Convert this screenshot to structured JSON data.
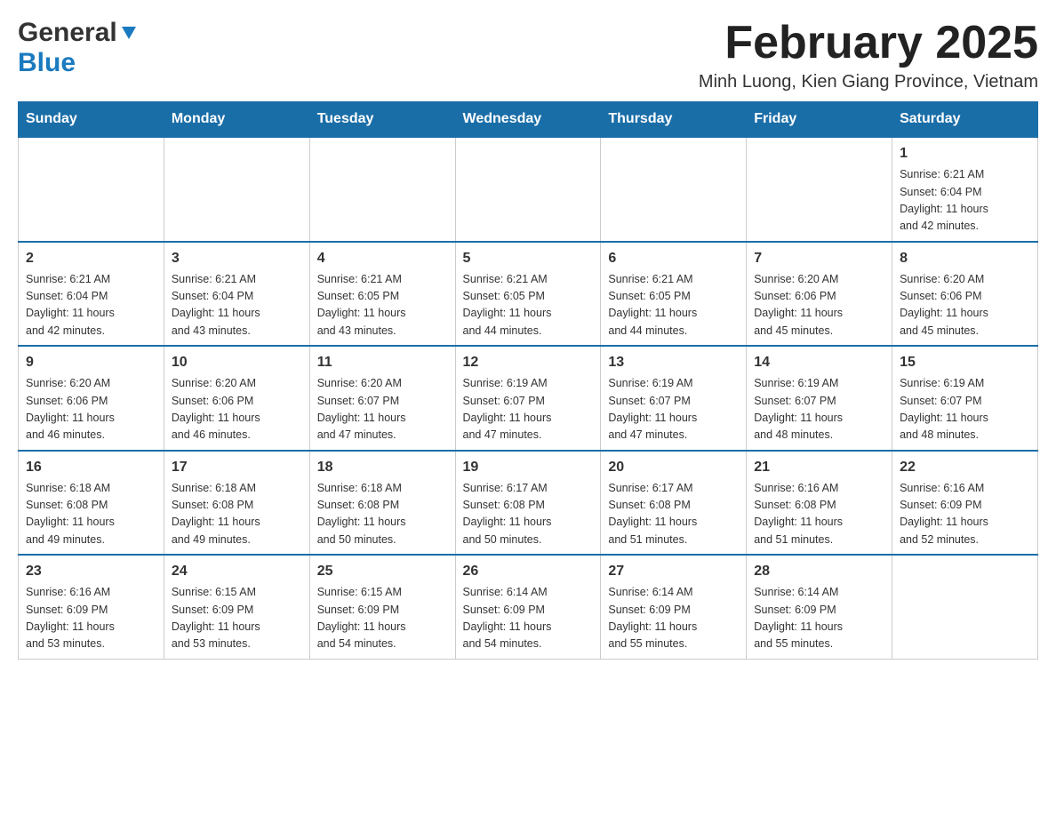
{
  "header": {
    "logo_general": "General",
    "logo_blue": "Blue",
    "month_title": "February 2025",
    "location": "Minh Luong, Kien Giang Province, Vietnam"
  },
  "weekdays": [
    "Sunday",
    "Monday",
    "Tuesday",
    "Wednesday",
    "Thursday",
    "Friday",
    "Saturday"
  ],
  "weeks": [
    [
      {
        "day": "",
        "info": ""
      },
      {
        "day": "",
        "info": ""
      },
      {
        "day": "",
        "info": ""
      },
      {
        "day": "",
        "info": ""
      },
      {
        "day": "",
        "info": ""
      },
      {
        "day": "",
        "info": ""
      },
      {
        "day": "1",
        "info": "Sunrise: 6:21 AM\nSunset: 6:04 PM\nDaylight: 11 hours\nand 42 minutes."
      }
    ],
    [
      {
        "day": "2",
        "info": "Sunrise: 6:21 AM\nSunset: 6:04 PM\nDaylight: 11 hours\nand 42 minutes."
      },
      {
        "day": "3",
        "info": "Sunrise: 6:21 AM\nSunset: 6:04 PM\nDaylight: 11 hours\nand 43 minutes."
      },
      {
        "day": "4",
        "info": "Sunrise: 6:21 AM\nSunset: 6:05 PM\nDaylight: 11 hours\nand 43 minutes."
      },
      {
        "day": "5",
        "info": "Sunrise: 6:21 AM\nSunset: 6:05 PM\nDaylight: 11 hours\nand 44 minutes."
      },
      {
        "day": "6",
        "info": "Sunrise: 6:21 AM\nSunset: 6:05 PM\nDaylight: 11 hours\nand 44 minutes."
      },
      {
        "day": "7",
        "info": "Sunrise: 6:20 AM\nSunset: 6:06 PM\nDaylight: 11 hours\nand 45 minutes."
      },
      {
        "day": "8",
        "info": "Sunrise: 6:20 AM\nSunset: 6:06 PM\nDaylight: 11 hours\nand 45 minutes."
      }
    ],
    [
      {
        "day": "9",
        "info": "Sunrise: 6:20 AM\nSunset: 6:06 PM\nDaylight: 11 hours\nand 46 minutes."
      },
      {
        "day": "10",
        "info": "Sunrise: 6:20 AM\nSunset: 6:06 PM\nDaylight: 11 hours\nand 46 minutes."
      },
      {
        "day": "11",
        "info": "Sunrise: 6:20 AM\nSunset: 6:07 PM\nDaylight: 11 hours\nand 47 minutes."
      },
      {
        "day": "12",
        "info": "Sunrise: 6:19 AM\nSunset: 6:07 PM\nDaylight: 11 hours\nand 47 minutes."
      },
      {
        "day": "13",
        "info": "Sunrise: 6:19 AM\nSunset: 6:07 PM\nDaylight: 11 hours\nand 47 minutes."
      },
      {
        "day": "14",
        "info": "Sunrise: 6:19 AM\nSunset: 6:07 PM\nDaylight: 11 hours\nand 48 minutes."
      },
      {
        "day": "15",
        "info": "Sunrise: 6:19 AM\nSunset: 6:07 PM\nDaylight: 11 hours\nand 48 minutes."
      }
    ],
    [
      {
        "day": "16",
        "info": "Sunrise: 6:18 AM\nSunset: 6:08 PM\nDaylight: 11 hours\nand 49 minutes."
      },
      {
        "day": "17",
        "info": "Sunrise: 6:18 AM\nSunset: 6:08 PM\nDaylight: 11 hours\nand 49 minutes."
      },
      {
        "day": "18",
        "info": "Sunrise: 6:18 AM\nSunset: 6:08 PM\nDaylight: 11 hours\nand 50 minutes."
      },
      {
        "day": "19",
        "info": "Sunrise: 6:17 AM\nSunset: 6:08 PM\nDaylight: 11 hours\nand 50 minutes."
      },
      {
        "day": "20",
        "info": "Sunrise: 6:17 AM\nSunset: 6:08 PM\nDaylight: 11 hours\nand 51 minutes."
      },
      {
        "day": "21",
        "info": "Sunrise: 6:16 AM\nSunset: 6:08 PM\nDaylight: 11 hours\nand 51 minutes."
      },
      {
        "day": "22",
        "info": "Sunrise: 6:16 AM\nSunset: 6:09 PM\nDaylight: 11 hours\nand 52 minutes."
      }
    ],
    [
      {
        "day": "23",
        "info": "Sunrise: 6:16 AM\nSunset: 6:09 PM\nDaylight: 11 hours\nand 53 minutes."
      },
      {
        "day": "24",
        "info": "Sunrise: 6:15 AM\nSunset: 6:09 PM\nDaylight: 11 hours\nand 53 minutes."
      },
      {
        "day": "25",
        "info": "Sunrise: 6:15 AM\nSunset: 6:09 PM\nDaylight: 11 hours\nand 54 minutes."
      },
      {
        "day": "26",
        "info": "Sunrise: 6:14 AM\nSunset: 6:09 PM\nDaylight: 11 hours\nand 54 minutes."
      },
      {
        "day": "27",
        "info": "Sunrise: 6:14 AM\nSunset: 6:09 PM\nDaylight: 11 hours\nand 55 minutes."
      },
      {
        "day": "28",
        "info": "Sunrise: 6:14 AM\nSunset: 6:09 PM\nDaylight: 11 hours\nand 55 minutes."
      },
      {
        "day": "",
        "info": ""
      }
    ]
  ]
}
